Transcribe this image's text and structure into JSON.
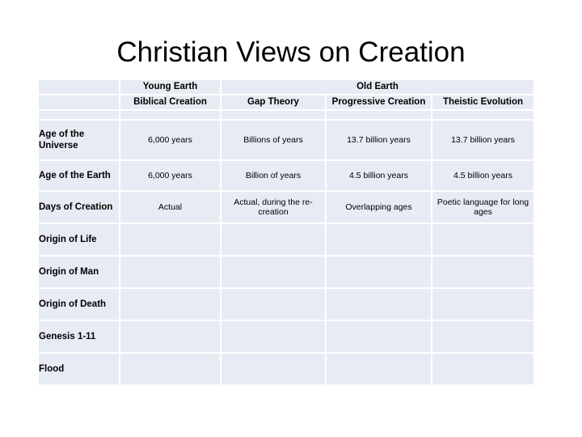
{
  "slide": {
    "title": "Christian Views on Creation"
  },
  "table": {
    "group_headers": [
      {
        "label": "",
        "span": 1
      },
      {
        "label": "Young Earth",
        "span": 1
      },
      {
        "label": "Old Earth",
        "span": 3
      }
    ],
    "sub_headers": [
      "",
      "Biblical Creation",
      "Gap Theory",
      "Progressive Creation",
      "Theistic Evolution"
    ],
    "rows": [
      {
        "label": "Age of the Universe",
        "cells": [
          "6,000 years",
          "Billions of years",
          "13.7 billion years",
          "13.7 billion years"
        ]
      },
      {
        "label": "Age of the Earth",
        "cells": [
          "6,000 years",
          "Billion of years",
          "4.5 billion years",
          "4.5 billion years"
        ]
      },
      {
        "label": "Days of Creation",
        "cells": [
          "Actual",
          "Actual, during the re-creation",
          "Overlapping ages",
          "Poetic language for long ages"
        ]
      },
      {
        "label": "Origin of Life",
        "cells": [
          "",
          "",
          "",
          ""
        ]
      },
      {
        "label": "Origin of Man",
        "cells": [
          "",
          "",
          "",
          ""
        ]
      },
      {
        "label": "Origin of Death",
        "cells": [
          "",
          "",
          "",
          ""
        ]
      },
      {
        "label": "Genesis 1-11",
        "cells": [
          "",
          "",
          "",
          ""
        ]
      },
      {
        "label": "Flood",
        "cells": [
          "",
          "",
          "",
          ""
        ]
      }
    ]
  },
  "colors": {
    "cell_fill": "#e7ebf3",
    "page_background": "#ffffff",
    "text": "#000000"
  }
}
